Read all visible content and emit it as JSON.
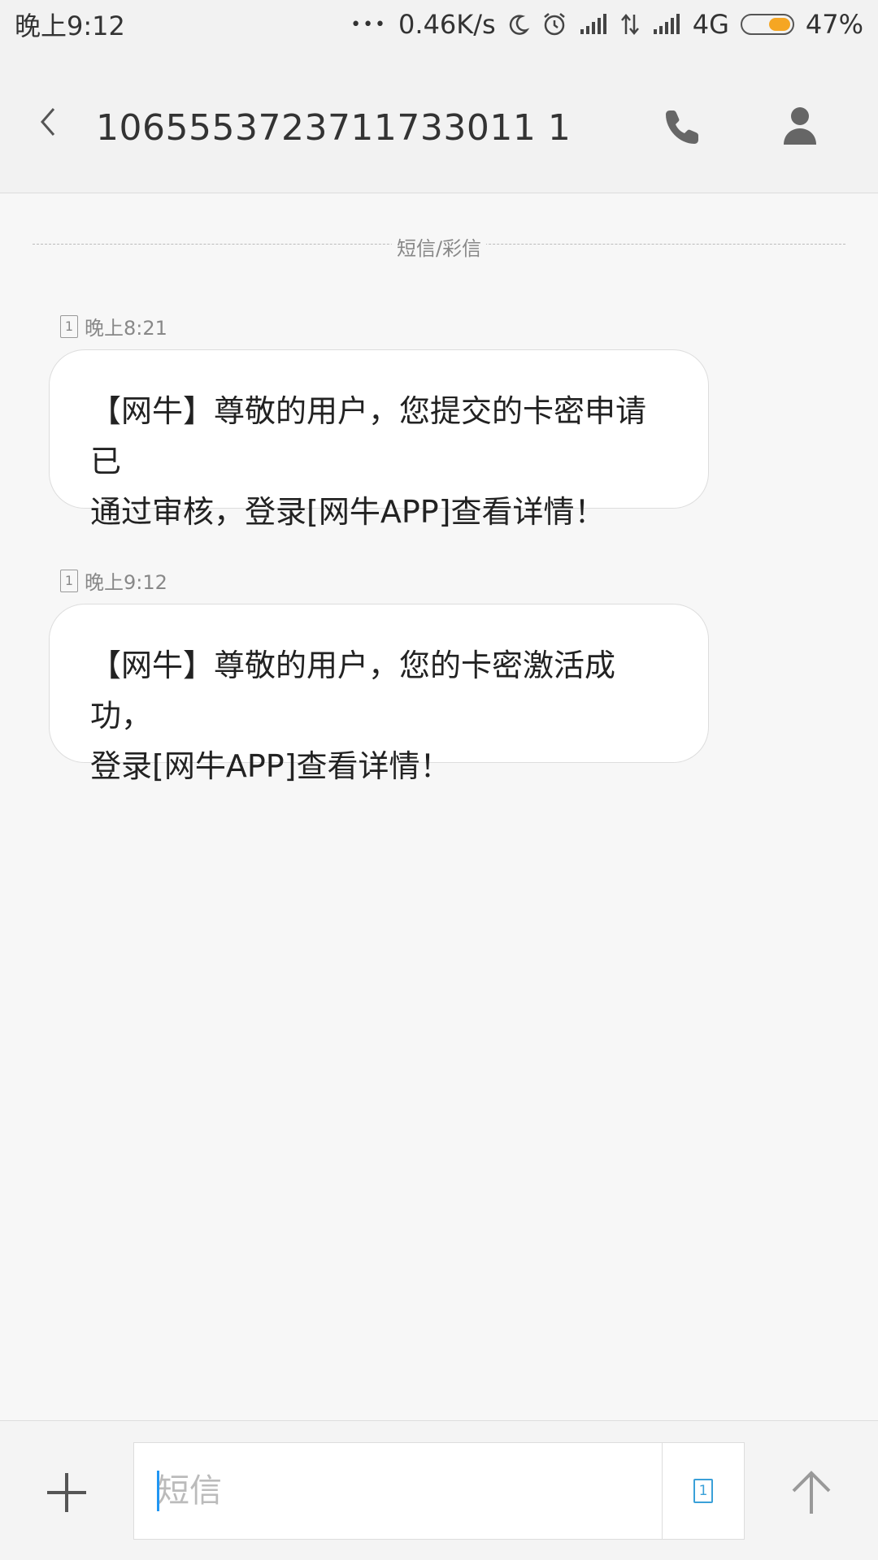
{
  "status_bar": {
    "time": "晚上9:12",
    "dots": "•••",
    "speed": "0.46K/s",
    "network": "4G",
    "battery_percent": "47%",
    "battery_level": 0.47
  },
  "header": {
    "contact_number": "1065553723711733011 1"
  },
  "conversation": {
    "channel_label": "短信/彩信",
    "messages": [
      {
        "sim": "1",
        "time": "晚上8:21",
        "text_line1": "【网牛】尊敬的用户，您提交的卡密申请已",
        "text_line2": "通过审核，登录[网牛APP]查看详情！"
      },
      {
        "sim": "1",
        "time": "晚上9:12",
        "text_line1": "【网牛】尊敬的用户，您的卡密激活成功，",
        "text_line2": "登录[网牛APP]查看详情！"
      }
    ]
  },
  "compose": {
    "placeholder": "短信",
    "sim": "1"
  },
  "colors": {
    "accent": "#2196f3",
    "battery": "#f5a623"
  }
}
